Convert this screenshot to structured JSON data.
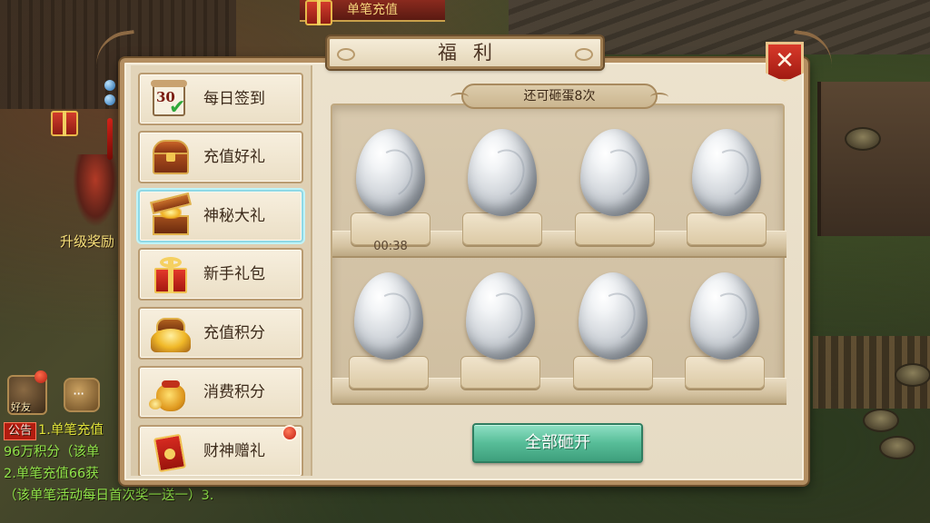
{
  "background": {
    "banner_text": "单笔充值",
    "level_reward_label": "升级奖励",
    "friend_label": "好友"
  },
  "announcement": {
    "tag": "公告",
    "lines": [
      "1.单笔充值",
      "96万积分（该单",
      "2.单笔充值66获",
      "（该单笔活动每日首次奖一送一）3."
    ]
  },
  "panel": {
    "title": "福利",
    "close_label": "✕"
  },
  "sidebar": {
    "items": [
      {
        "label": "每日签到",
        "icon": "calendar-check-icon",
        "active": false,
        "badge": false
      },
      {
        "label": "充值好礼",
        "icon": "treasure-chest-icon",
        "active": false,
        "badge": false
      },
      {
        "label": "神秘大礼",
        "icon": "mystery-chest-icon",
        "active": true,
        "badge": false
      },
      {
        "label": "新手礼包",
        "icon": "gift-box-icon",
        "active": false,
        "badge": false
      },
      {
        "label": "充值积分",
        "icon": "gold-chest-icon",
        "active": false,
        "badge": false
      },
      {
        "label": "消费积分",
        "icon": "money-bag-icon",
        "active": false,
        "badge": false
      },
      {
        "label": "财神赠礼",
        "icon": "red-envelope-icon",
        "active": false,
        "badge": true
      }
    ]
  },
  "eggs": {
    "remaining_text": "还可砸蛋8次",
    "slots": [
      {
        "row": 1,
        "col": 1,
        "timer": "00:38"
      },
      {
        "row": 1,
        "col": 2,
        "timer": ""
      },
      {
        "row": 1,
        "col": 3,
        "timer": ""
      },
      {
        "row": 1,
        "col": 4,
        "timer": ""
      },
      {
        "row": 2,
        "col": 1,
        "timer": ""
      },
      {
        "row": 2,
        "col": 2,
        "timer": ""
      },
      {
        "row": 2,
        "col": 3,
        "timer": ""
      },
      {
        "row": 2,
        "col": 4,
        "timer": ""
      }
    ],
    "smash_all_label": "全部砸开"
  },
  "colors": {
    "accent_green": "#57bd98",
    "close_red": "#c8281a",
    "active_glow": "#8fd9e6",
    "panel_bg": "#e6dbc4"
  }
}
